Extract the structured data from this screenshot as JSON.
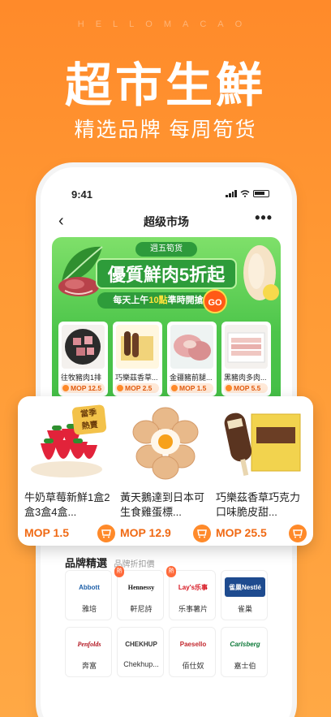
{
  "banner": {
    "hello_text": "HELLOMACAO",
    "title": "超市生鮮",
    "subtitle": "精选品牌 每周筍货"
  },
  "statusbar": {
    "time": "9:41"
  },
  "navbar": {
    "title": "超级市场",
    "back_icon": "chevron-left-icon",
    "more_label": "•••"
  },
  "promo": {
    "tag": "週五筍货",
    "title": "優質鮮肉5折起",
    "time_prefix": "每天上午",
    "time_highlight": "10點",
    "time_suffix": "準時開搶",
    "go_label": "GO",
    "items": [
      {
        "name": "往牧豬肉1排",
        "price": "MOP 12.5"
      },
      {
        "name": "巧樂茲香草...",
        "price": "MOP 2.5"
      },
      {
        "name": "金疆豬前腿...",
        "price": "MOP 1.5"
      },
      {
        "name": "黑豬肉多肉...",
        "price": "MOP 5.5"
      }
    ]
  },
  "featured": {
    "season_badge_line1": "當季",
    "season_badge_line2": "熱賣",
    "items": [
      {
        "name": "牛奶草莓新鮮1盒2盒3盒4盒...",
        "price": "MOP 1.5"
      },
      {
        "name": "黃天鵝達到日本可生食雞蛋標...",
        "price": "MOP 12.9"
      },
      {
        "name": "巧樂茲香草巧克力口味脆皮甜...",
        "price": "MOP 25.5"
      }
    ]
  },
  "brands": {
    "title": "品牌精選",
    "subtitle": "品牌折扣價",
    "hot_badge": "熱",
    "items": [
      {
        "name": "雅培",
        "logo_text": "Abbott"
      },
      {
        "name": "軒尼詩",
        "logo_text": "Hennessy"
      },
      {
        "name": "乐事薯片",
        "logo_text": "Lay's乐事"
      },
      {
        "name": "雀巢",
        "logo_text": "雀巢Nestlé"
      },
      {
        "name": "奔富",
        "logo_text": "Penfolds"
      },
      {
        "name": "Chekhup...",
        "logo_text": "CHEKHUP"
      },
      {
        "name": "佰仕奴",
        "logo_text": "Paesello"
      },
      {
        "name": "嘉士伯",
        "logo_text": "Carlsberg"
      }
    ]
  },
  "colors": {
    "accent": "#ff8a2a",
    "price": "#f06a14",
    "promo_green": "#4cc54a"
  }
}
